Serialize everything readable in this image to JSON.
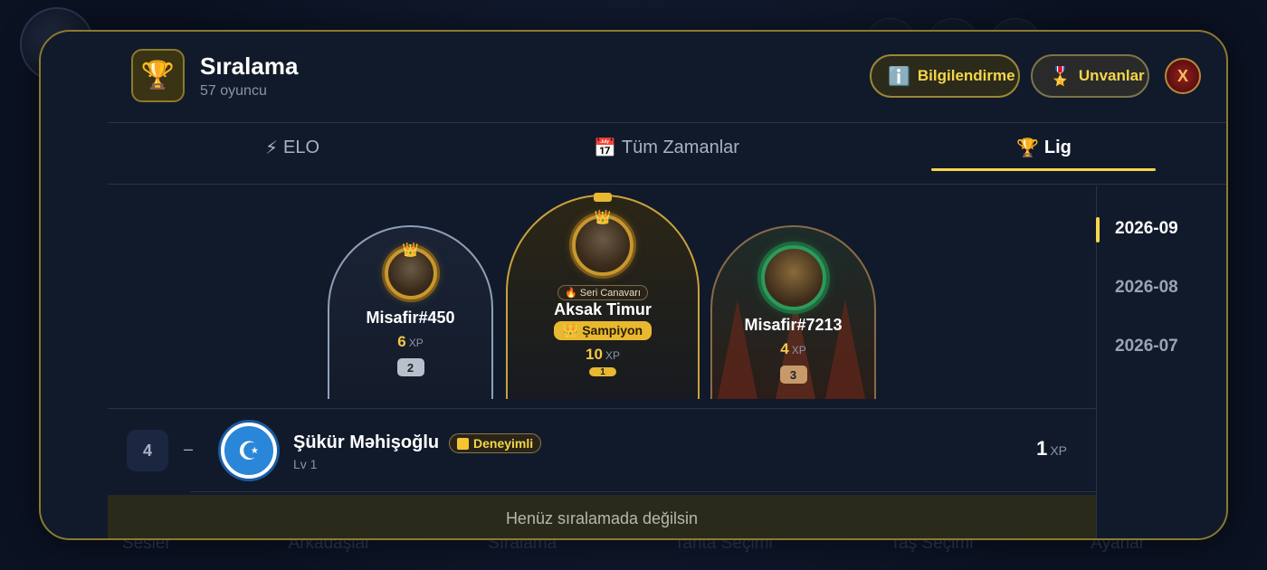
{
  "background": {
    "nav": [
      "Sesler",
      "Arkadaşlar",
      "Sıralama",
      "Tahta Seçimi",
      "Taş Seçimi",
      "Ayarlar"
    ]
  },
  "header": {
    "title": "Sıralama",
    "subtitle": "57 oyuncu",
    "info_button": "Bilgilendirme",
    "titles_button": "Unvanlar",
    "close_label": "X"
  },
  "tabs": [
    {
      "icon": "⚡",
      "label": "ELO"
    },
    {
      "icon": "📅",
      "label": "Tüm Zamanlar"
    },
    {
      "icon": "🏆",
      "label": "Lig"
    }
  ],
  "active_tab": "Lig",
  "periods": [
    "2026-09",
    "2026-08",
    "2026-07"
  ],
  "active_period": "2026-09",
  "podium": {
    "first": {
      "name": "Aksak Timur",
      "xp": "10",
      "xp_unit": "XP",
      "rank": "1",
      "streak_badge": "🔥 Seri Canavarı",
      "title_badge": "👑 Şampiyon"
    },
    "second": {
      "name": "Misafir#450",
      "xp": "6",
      "xp_unit": "XP",
      "rank": "2"
    },
    "third": {
      "name": "Misafir#7213",
      "xp": "4",
      "xp_unit": "XP",
      "rank": "3"
    }
  },
  "list": [
    {
      "rank": "4",
      "change": "–",
      "name": "Şükür Məhişoğlu",
      "badge": "Deneyimli",
      "level": "Lv 1",
      "xp": "1",
      "xp_unit": "XP"
    }
  ],
  "notice": "Henüz sıralamada değilsin",
  "colors": {
    "accent": "#f4d64a",
    "modal_bg": "#111a2b",
    "border_gold": "#8a7a2e"
  }
}
